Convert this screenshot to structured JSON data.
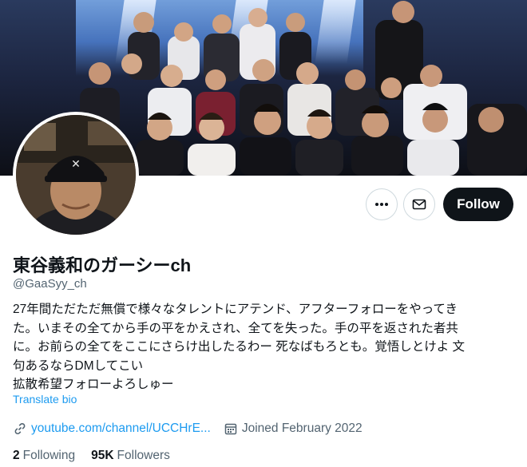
{
  "profile": {
    "display_name": "東谷義和のガーシーch",
    "handle": "@GaaSyy_ch",
    "bio_lines": [
      "27年間ただただ無償で様々なタレントにアテンド、アフターフォローをやってき",
      "た。いまその全てから手の平をかえされ、全てを失った。手の平を返された者共",
      "に。お前らの全てをここにさらけ出したるわー 死なばもろとも。覚悟しとけよ 文",
      "句あるならDMしてこい",
      "拡散希望フォローよろしゅー"
    ],
    "translate_label": "Translate bio",
    "link_text": "youtube.com/channel/UCCHrE...",
    "joined_text": "Joined February 2022",
    "following_count": "2",
    "following_label": "Following",
    "followers_count": "95K",
    "followers_label": "Followers"
  },
  "actions": {
    "more_icon": "more-horizontal-icon",
    "message_icon": "envelope-icon",
    "follow_label": "Follow"
  },
  "icons": {
    "link": "link-icon",
    "calendar": "calendar-icon"
  },
  "colors": {
    "accent": "#1d9bf0",
    "follow_button_bg": "#0f1419",
    "secondary_text": "#536471"
  }
}
